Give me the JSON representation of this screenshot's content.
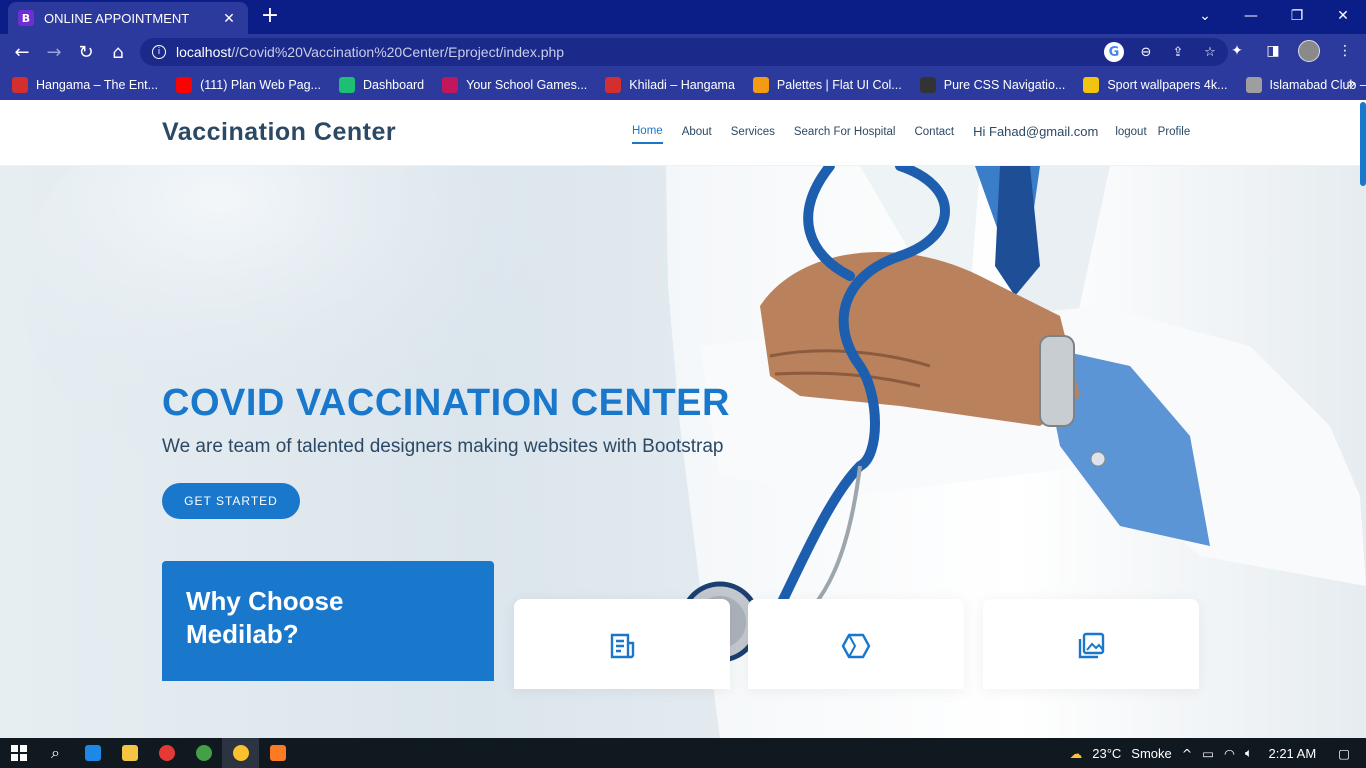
{
  "browser": {
    "tab_title": "ONLINE APPOINTMENT",
    "tab_favicon_letter": "B",
    "url_host": "localhost",
    "url_path": "//Covid%20Vaccination%20Center/Eproject/index.php",
    "bookmarks": [
      {
        "label": "Hangama – The Ent...",
        "icon": "hangama-icon",
        "color": "#d32f2f"
      },
      {
        "label": "(111) Plan Web Pag...",
        "icon": "youtube-icon",
        "color": "#ff0000"
      },
      {
        "label": "Dashboard",
        "icon": "fiverr-icon",
        "color": "#1dbf73"
      },
      {
        "label": "Your School Games...",
        "icon": "school-games-icon",
        "color": "#c2185b"
      },
      {
        "label": "Khiladi – Hangama",
        "icon": "hangama-icon",
        "color": "#d32f2f"
      },
      {
        "label": "Palettes | Flat UI Col...",
        "icon": "flatui-icon",
        "color": "#f39c12"
      },
      {
        "label": "Pure CSS Navigatio...",
        "icon": "css-icon",
        "color": "#333333"
      },
      {
        "label": "Sport wallpapers 4k...",
        "icon": "wallpaper-icon",
        "color": "#f1c40f"
      },
      {
        "label": "Islamabad Club –...",
        "icon": "globe-icon",
        "color": "#9e9e9e"
      }
    ]
  },
  "site": {
    "logo": "Vaccination Center",
    "nav": [
      {
        "label": "Home",
        "active": true
      },
      {
        "label": "About"
      },
      {
        "label": "Services"
      },
      {
        "label": "Search For Hospital"
      },
      {
        "label": "Contact"
      }
    ],
    "user_greeting": "Hi Fahad@gmail.com",
    "logout": "logout",
    "profile": "Profile"
  },
  "hero": {
    "title": "COVID VACCINATION CENTER",
    "subtitle": "We are team of talented designers making websites with Bootstrap",
    "cta": "GET STARTED"
  },
  "why": {
    "title_line1": "Why Choose",
    "title_line2": "Medilab?"
  },
  "icon_boxes": [
    {
      "icon": "receipt-icon"
    },
    {
      "icon": "cube-icon"
    },
    {
      "icon": "images-icon"
    }
  ],
  "colors": {
    "accent": "#1977cc",
    "heading": "#2c4964",
    "browser_frame": "#2c3a9e",
    "tabbar": "#0b1e88"
  },
  "taskbar": {
    "weather": "23°C",
    "weather_label": "Smoke",
    "time": "2:21 AM"
  }
}
